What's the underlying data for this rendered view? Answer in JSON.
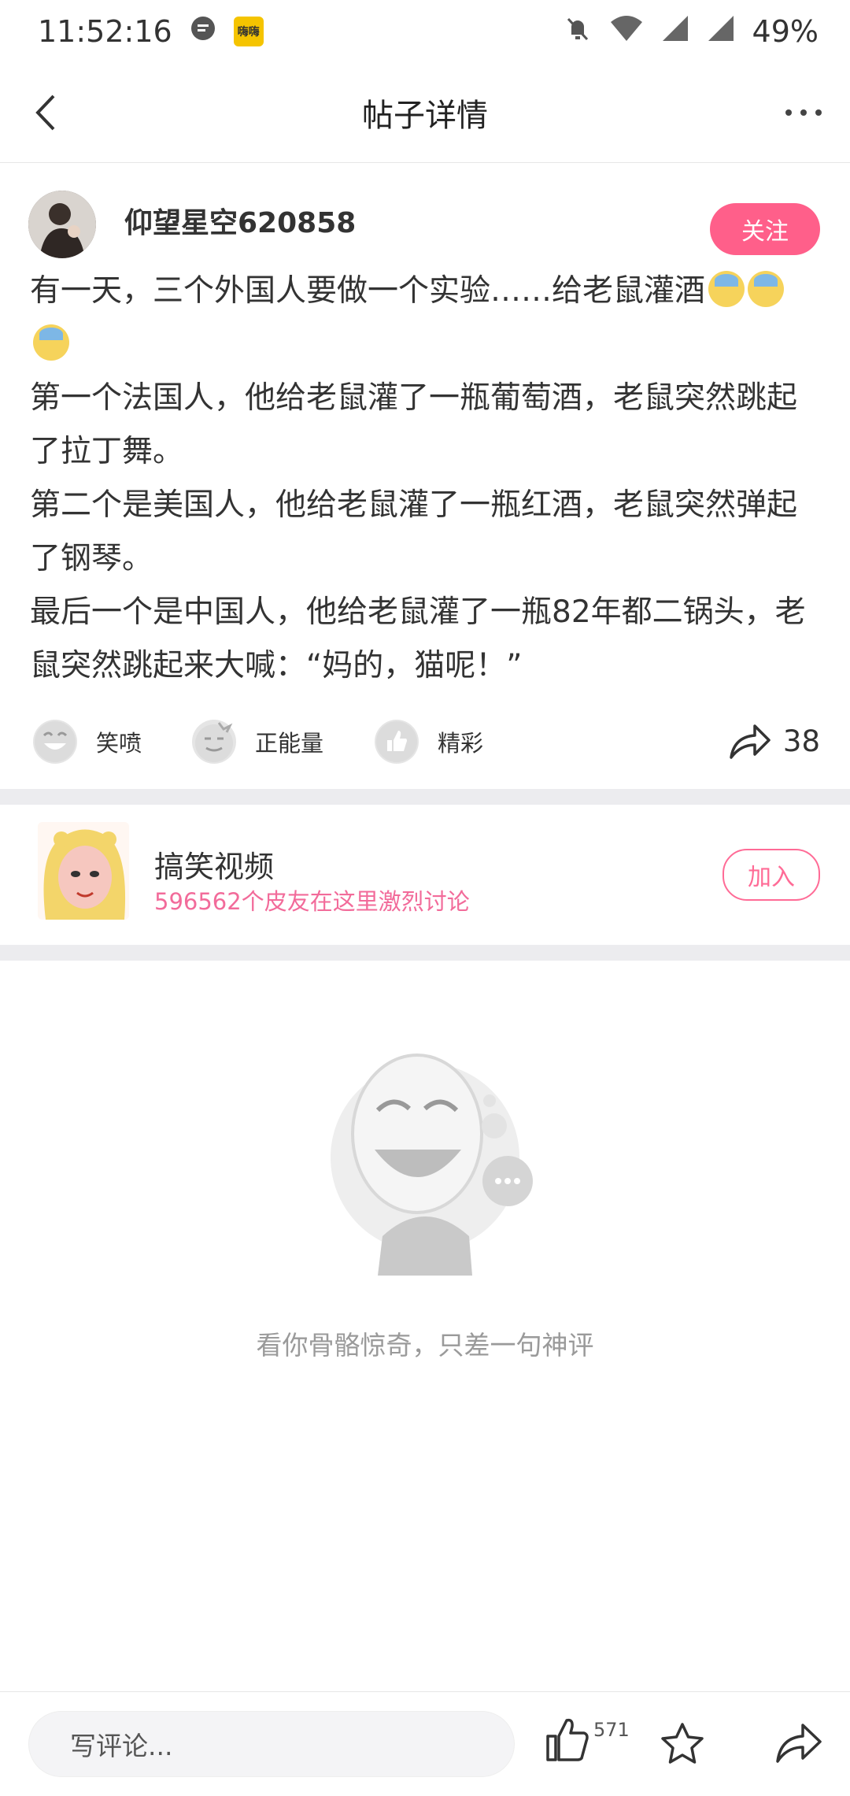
{
  "status_bar": {
    "time": "11:52:16",
    "app_badge_text": "嗨嗨",
    "battery": "49%"
  },
  "nav": {
    "title": "帖子详情"
  },
  "post": {
    "author": "仰望星空620858",
    "follow_label": "关注",
    "lines": [
      "有一天，三个外国人要做一个实验……给老鼠灌酒",
      "第一个法国人，他给老鼠灌了一瓶葡萄酒，老鼠突然跳起了拉丁舞。",
      "第二个是美国人，他给老鼠灌了一瓶红酒，老鼠突然弹起了钢琴。",
      "最后一个是中国人，他给老鼠灌了一瓶82年都二锅头，老鼠突然跳起来大喊：“妈的，猫呢！”"
    ],
    "reactions": [
      {
        "label": "笑喷"
      },
      {
        "label": "正能量"
      },
      {
        "label": "精彩"
      }
    ],
    "share_count": "38"
  },
  "group": {
    "name": "搞笑视频",
    "description": "596562个皮友在这里激烈讨论",
    "join_label": "加入"
  },
  "empty_state": {
    "text": "看你骨骼惊奇，只差一句神评"
  },
  "bottom_bar": {
    "comment_placeholder": "写评论...",
    "like_count": "571"
  },
  "colors": {
    "accent": "#ff5f8a",
    "group_desc": "#f26b9a"
  }
}
